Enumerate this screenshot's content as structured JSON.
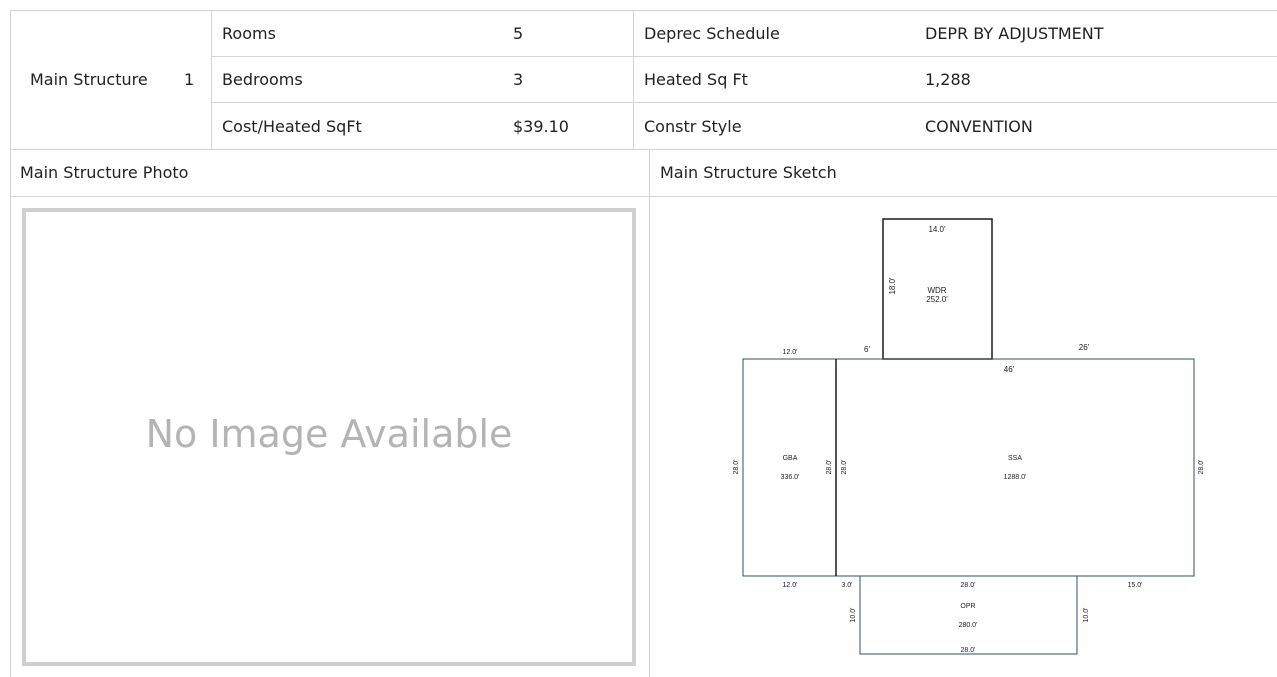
{
  "structure": {
    "label": "Main Structure",
    "number": "1"
  },
  "details": {
    "rows": [
      {
        "label": "Rooms",
        "value": "5",
        "label2": "Deprec Schedule",
        "value2": "DEPR BY ADJUSTMENT"
      },
      {
        "label": "Bedrooms",
        "value": "3",
        "label2": "Heated Sq Ft",
        "value2": "1,288"
      },
      {
        "label": "Cost/Heated SqFt",
        "value": "$39.10",
        "label2": "Constr Style",
        "value2": "CONVENTION"
      }
    ]
  },
  "photo": {
    "header": "Main Structure Photo",
    "placeholder": "No Image Available"
  },
  "sketch": {
    "header": "Main Structure Sketch",
    "labels": {
      "wdr_top": "14.0'",
      "wdr_side": "18.0'",
      "wdr_name": "WDR",
      "wdr_area": "252.0'",
      "gba_top": "12.0'",
      "six": "6'",
      "twentysix": "26'",
      "fortysix": "46'",
      "gba_left": "28.0'",
      "gba_name": "GBA",
      "gba_area": "336.0'",
      "gba_right": "28.0'",
      "ssa_left": "28.0'",
      "ssa_name": "SSA",
      "ssa_area": "1288.0'",
      "ssa_right": "28.0'",
      "gba_bottom": "12.0'",
      "three": "3.0'",
      "opr_top": "28.0'",
      "fifteen": "15.0'",
      "opr_left": "10.0'",
      "opr_name": "OPR",
      "opr_area": "280.0'",
      "opr_right": "10.0'",
      "opr_bottom": "28.0'"
    }
  }
}
